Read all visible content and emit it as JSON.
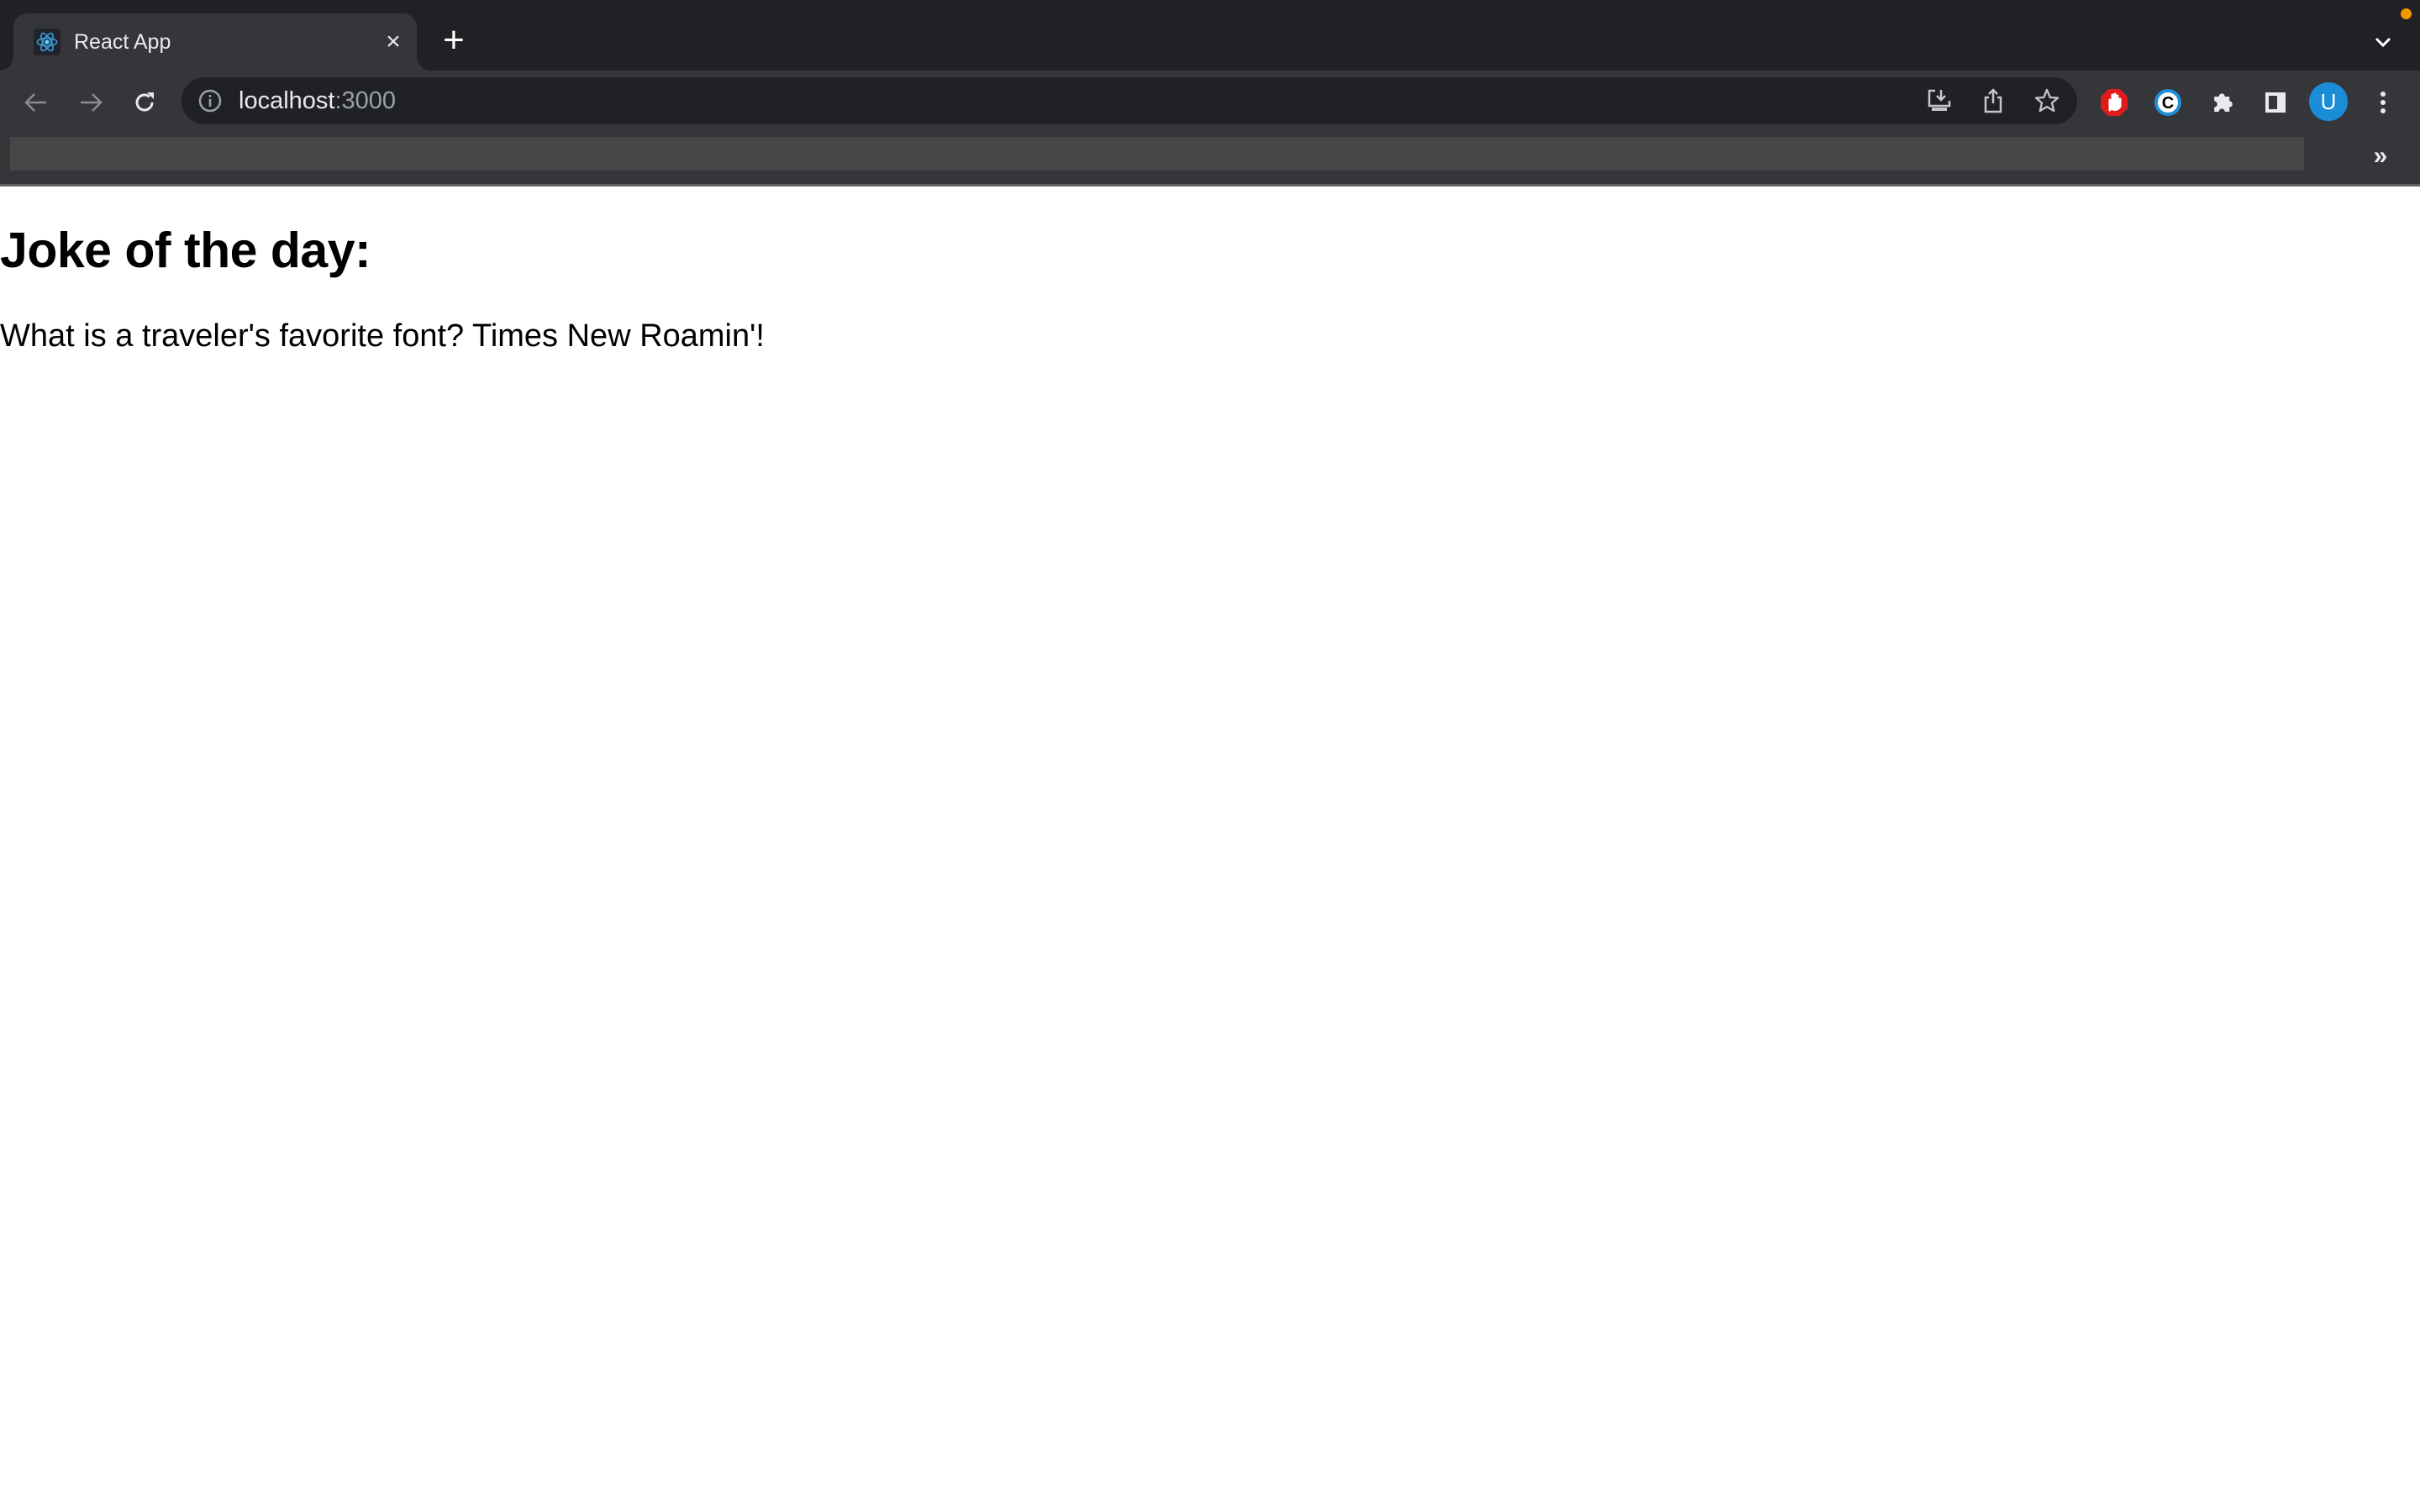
{
  "browser": {
    "tabs": [
      {
        "title": "React App",
        "favicon": "react-logo-icon",
        "active": true
      }
    ],
    "new_tab_label": "+",
    "close_tab_label": "×",
    "address_bar": {
      "host": "localhost",
      "port": ":3000",
      "security_icon": "info-icon"
    },
    "address_bar_actions": [
      "install-app-icon",
      "share-icon",
      "bookmark-star-icon"
    ],
    "extensions": [
      "adblock-icon",
      "c-extension-icon",
      "extensions-puzzle-icon",
      "side-panel-icon"
    ],
    "profile_initial": "U",
    "bookmarks_overflow_label": "»",
    "colors": {
      "tabstrip": "#202124",
      "toolbar": "#35363a",
      "omnibox": "#202124",
      "avatar": "#1a8cd8",
      "notification_dot": "#f29900",
      "adblock": "#e01b1b",
      "c_extension": "#1e8fd6"
    }
  },
  "page": {
    "heading": "Joke of the day:",
    "joke": "What is a traveler's favorite font? Times New Roamin'!"
  }
}
